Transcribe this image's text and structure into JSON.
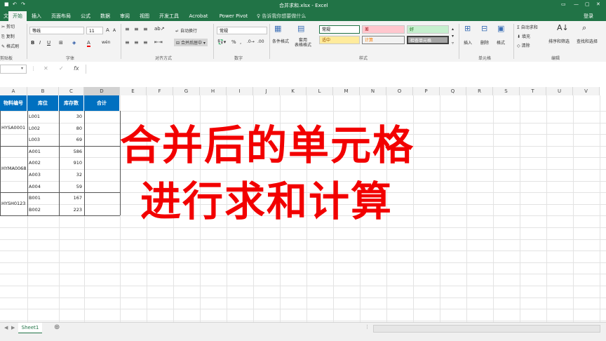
{
  "window": {
    "title": "合并求和.xlsx - Excel",
    "signin": "登录"
  },
  "tabs": [
    {
      "label": "文件"
    },
    {
      "label": "开始"
    },
    {
      "label": "插入"
    },
    {
      "label": "页面布局"
    },
    {
      "label": "公式"
    },
    {
      "label": "数据"
    },
    {
      "label": "审阅"
    },
    {
      "label": "视图"
    },
    {
      "label": "开发工具"
    },
    {
      "label": "Acrobat"
    },
    {
      "label": "Power Pivot"
    }
  ],
  "tellme": "告诉我你想要做什么",
  "ribbon": {
    "clipboard": {
      "cut": "剪切",
      "copy": "复制",
      "painter": "格式刷",
      "group": "剪贴板"
    },
    "font": {
      "name": "等线",
      "size": "11",
      "group": "字体"
    },
    "align": {
      "wrap": "自动换行",
      "merge": "合并后居中",
      "group": "对齐方式"
    },
    "number": {
      "format": "常规",
      "group": "数字"
    },
    "styles": {
      "cond": "条件格式",
      "table": "套用\n表格格式",
      "normal": "常规",
      "bad": "差",
      "good": "好",
      "neutral": "适中",
      "calc": "计算",
      "check": "检查单元格",
      "group": "样式"
    },
    "cells": {
      "insert": "插入",
      "delete": "删除",
      "format": "格式",
      "group": "单元格"
    },
    "editing": {
      "autosum": "自动求和",
      "fill": "填充",
      "clear": "清除",
      "sort": "排序和筛选",
      "find": "查找和选择",
      "group": "编辑"
    },
    "colors": {
      "bad": "#ffc7ce",
      "good": "#c6efce",
      "neutral": "#ffeb9c",
      "calc": "#f2f2f2",
      "check": "#a5a5a5"
    }
  },
  "formula": {
    "fx": "fx"
  },
  "columns": [
    "A",
    "B",
    "C",
    "D",
    "E",
    "F",
    "G",
    "H",
    "I",
    "J",
    "K",
    "L",
    "M",
    "N",
    "O",
    "P",
    "Q",
    "R",
    "S",
    "T",
    "U",
    "V"
  ],
  "table": {
    "headers": [
      "物料编号",
      "库位",
      "库存数",
      "合计"
    ],
    "groups": [
      {
        "code": "HYSA0001",
        "rows": [
          [
            "L001",
            "30"
          ],
          [
            "L002",
            "80"
          ],
          [
            "L003",
            "69"
          ]
        ]
      },
      {
        "code": "HYMA0068",
        "rows": [
          [
            "A001",
            "586"
          ],
          [
            "A002",
            "910"
          ],
          [
            "A003",
            "32"
          ],
          [
            "A004",
            "59"
          ]
        ]
      },
      {
        "code": "HYSH0123",
        "rows": [
          [
            "B001",
            "167"
          ],
          [
            "B002",
            "223"
          ]
        ]
      }
    ],
    "header_color": "#0070c0"
  },
  "overlay": {
    "line1": "合并后的单元格",
    "line2": "进行求和计算",
    "color": "#f20000"
  },
  "sheet": {
    "tab": "Sheet1"
  }
}
